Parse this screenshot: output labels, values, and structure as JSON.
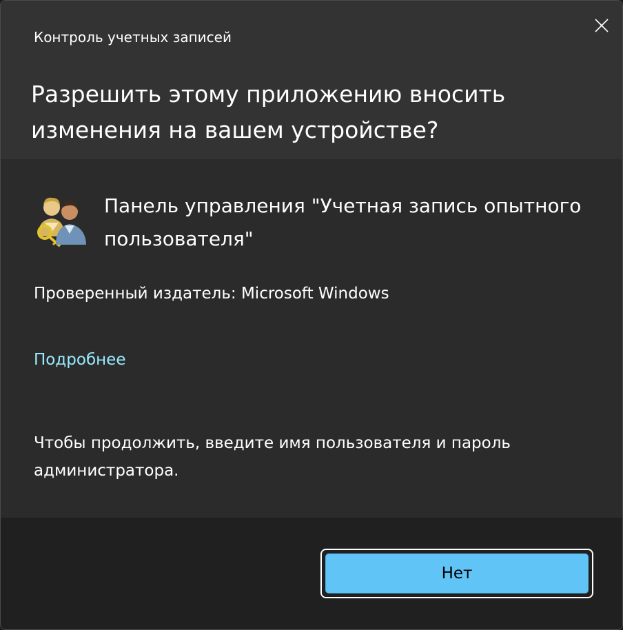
{
  "dialog": {
    "title": "Контроль учетных записей",
    "question": "Разрешить этому приложению вносить изменения на вашем устройстве?",
    "close_icon": "close-icon"
  },
  "app": {
    "icon": "user-accounts-icon",
    "name": "Панель управления \"Учетная запись опытного пользователя\"",
    "publisher": "Проверенный издатель: Microsoft Windows",
    "details_link": "Подробнее"
  },
  "instruction": "Чтобы продолжить, введите имя пользователя и пароль администратора.",
  "buttons": {
    "no_label": "Нет"
  },
  "colors": {
    "header_bg": "#333333",
    "body_bg": "#2b2b2b",
    "footer_bg": "#202020",
    "link": "#99ebff",
    "button_accent": "#60c4f7"
  }
}
